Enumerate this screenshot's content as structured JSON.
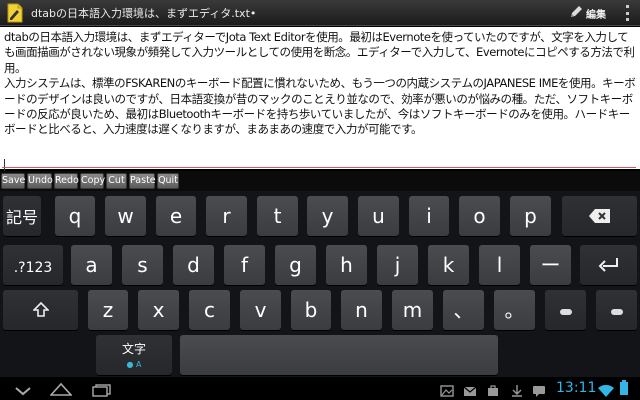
{
  "app": {
    "title": "dtabの日本語入力環境は、まずエディタ.txt•",
    "edit_label": "編集"
  },
  "editor": {
    "paragraphs": [
      "dtabの日本語入力環境は、まずエディターでJota Text Editorを使用。最初はEvernoteを使っていたのですが、文字を入力しても画面描画がされない現象が頻発して入力ツールとしての使用を断念。エディターで入力して、Evernoteにコピペする方法で利用。",
      "入力システムは、標準のFSKARENのキーボード配置に慣れないため、もう一つの内蔵システムのJAPANESE IMEを使用。キーボードのデザインは良いのですが、日本語変換が昔のマックのことえり並なので、効率が悪いのが悩みの種。ただ、ソフトキーボードの反応が良いため、最初はBluetoothキーボードを持ち歩いていましたが、今はソフトキーボードのみを使用。ハードキーボードと比べると、入力速度は遅くなりますが、まあまあの速度で入力が可能です。"
    ]
  },
  "toolbar": {
    "save": "Save",
    "undo": "Undo",
    "redo": "Redo",
    "copy": "Copy",
    "cut": "Cut",
    "paste": "Paste",
    "quit": "Quit"
  },
  "keyboard": {
    "row1": [
      "記号",
      "q",
      "w",
      "e",
      "r",
      "t",
      "y",
      "u",
      "i",
      "o",
      "p"
    ],
    "row2": [
      ".?123",
      "a",
      "s",
      "d",
      "f",
      "g",
      "h",
      "j",
      "k",
      "l",
      "ー"
    ],
    "row3": [
      "z",
      "x",
      "c",
      "v",
      "b",
      "n",
      "m",
      "、",
      "。"
    ],
    "moji": "文字",
    "moji_sub": "A"
  },
  "status": {
    "time": "13:11"
  },
  "colors": {
    "accent": "#33b5e5",
    "editor_bg": "#ffffff",
    "key_bg": "#3e4044",
    "keyboard_bg": "#121418"
  }
}
